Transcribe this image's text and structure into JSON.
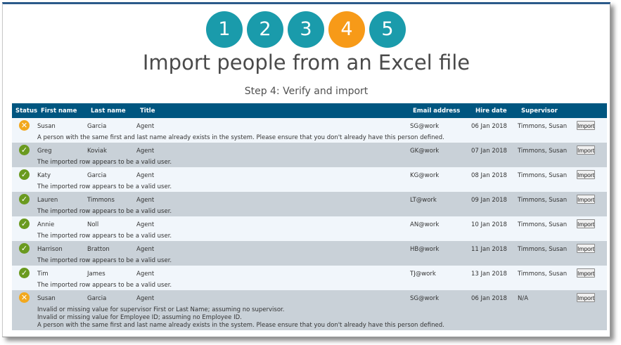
{
  "wizard": {
    "steps": [
      {
        "label": "1",
        "active": false
      },
      {
        "label": "2",
        "active": false
      },
      {
        "label": "3",
        "active": false
      },
      {
        "label": "4",
        "active": true
      },
      {
        "label": "5",
        "active": false
      }
    ],
    "title": "Import people from an Excel file",
    "subtitle": "Step 4: Verify and import"
  },
  "colors": {
    "step": "#1a9bab",
    "step_active": "#f79a18",
    "header": "#005680",
    "ok": "#6a9a1f",
    "warn": "#f2a81d"
  },
  "table": {
    "columns": [
      "Status",
      "First name",
      "Last name",
      "Title",
      "Email address",
      "Hire date",
      "Supervisor"
    ],
    "button_label": "Import",
    "rows": [
      {
        "status": "warning",
        "status_icon": "x-icon",
        "first": "Susan",
        "last": "Garcia",
        "title": "Agent",
        "email": "SG@work",
        "hire": "06 Jan 2018",
        "supervisor": "Timmons, Susan",
        "messages": [
          "A person with the same first and last name already exists in the system. Please ensure that you don't already have this person defined."
        ]
      },
      {
        "status": "valid",
        "status_icon": "check-icon",
        "first": "Greg",
        "last": "Koviak",
        "title": "Agent",
        "email": "GK@work",
        "hire": "07 Jan 2018",
        "supervisor": "Timmons, Susan",
        "messages": [
          "The imported row appears to be a valid user."
        ]
      },
      {
        "status": "valid",
        "status_icon": "check-icon",
        "first": "Katy",
        "last": "Garcia",
        "title": "Agent",
        "email": "KG@work",
        "hire": "08 Jan 2018",
        "supervisor": "Timmons, Susan",
        "messages": [
          "The imported row appears to be a valid user."
        ]
      },
      {
        "status": "valid",
        "status_icon": "check-icon",
        "first": "Lauren",
        "last": "Timmons",
        "title": "Agent",
        "email": "LT@work",
        "hire": "09 Jan 2018",
        "supervisor": "Timmons, Susan",
        "messages": [
          "The imported row appears to be a valid user."
        ]
      },
      {
        "status": "valid",
        "status_icon": "check-icon",
        "first": "Annie",
        "last": "Noll",
        "title": "Agent",
        "email": "AN@work",
        "hire": "10 Jan 2018",
        "supervisor": "Timmons, Susan",
        "messages": [
          "The imported row appears to be a valid user."
        ]
      },
      {
        "status": "valid",
        "status_icon": "check-icon",
        "first": "Harrison",
        "last": "Bratton",
        "title": "Agent",
        "email": "HB@work",
        "hire": "11 Jan 2018",
        "supervisor": "Timmons, Susan",
        "messages": [
          "The imported row appears to be a valid user."
        ]
      },
      {
        "status": "valid",
        "status_icon": "check-icon",
        "first": "Tim",
        "last": "James",
        "title": "Agent",
        "email": "TJ@work",
        "hire": "13 Jan 2018",
        "supervisor": "Timmons, Susan",
        "messages": [
          "The imported row appears to be a valid user."
        ]
      },
      {
        "status": "warning",
        "status_icon": "x-icon",
        "first": "Susan",
        "last": "Garcia",
        "title": "Agent",
        "email": "SG@work",
        "hire": "06 Jan 2018",
        "supervisor": "N/A",
        "messages": [
          "Invalid or missing value for supervisor First or Last Name; assuming no supervisor.",
          "Invalid or missing value for Employee ID; assuming no Employee ID.",
          "A person with the same first and last name already exists in the system. Please ensure that you don't already have this person defined."
        ]
      }
    ]
  }
}
